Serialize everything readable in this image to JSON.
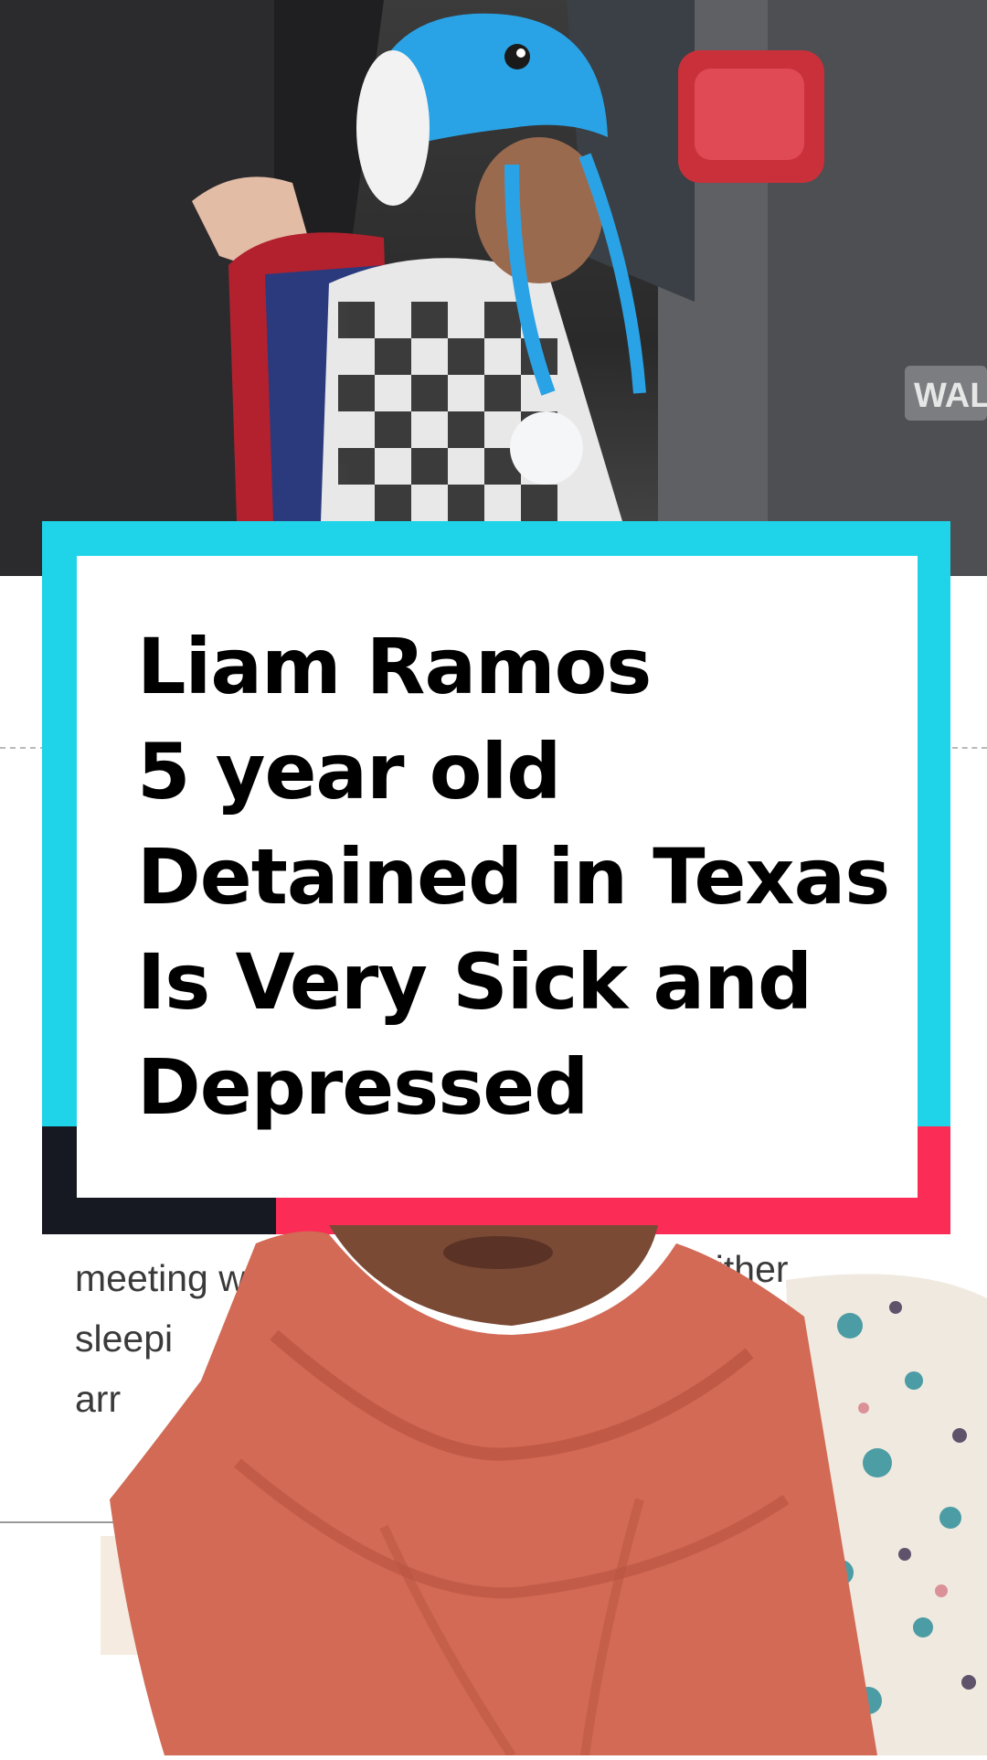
{
  "title_card": {
    "lines": [
      "Liam Ramos",
      "5 year old",
      "Detained in Texas",
      "Is Very Sick and",
      "Depressed"
    ]
  },
  "article_snippet": {
    "lines": [
      "meeting w",
      "sleepi",
      "arr"
    ],
    "right_fragment": "either"
  },
  "vehicle_badge": "WAL",
  "colors": {
    "cyan": "#1fd3e9",
    "pink": "#fb2c55",
    "dark": "#161922",
    "scarf": "#d26a55",
    "hat": "#2aa3e6"
  }
}
